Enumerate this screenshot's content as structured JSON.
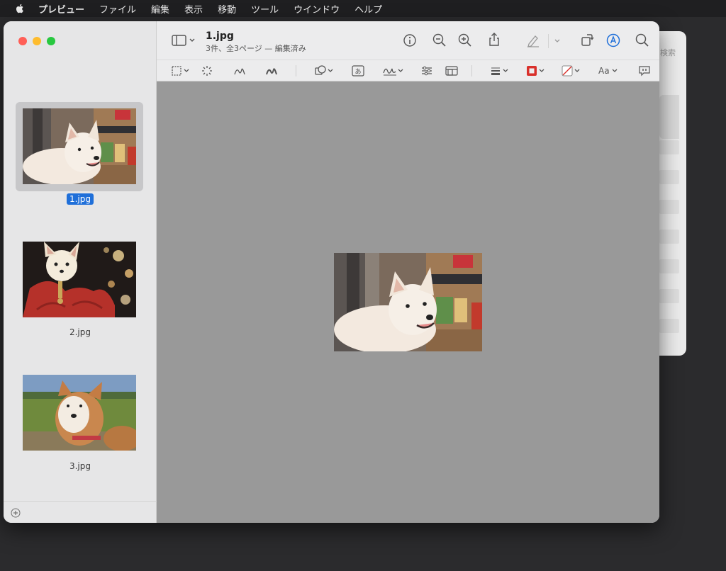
{
  "menubar": {
    "items": [
      "プレビュー",
      "ファイル",
      "編集",
      "表示",
      "移動",
      "ツール",
      "ウインドウ",
      "ヘルプ"
    ]
  },
  "background_window": {
    "search_label": "検索"
  },
  "window": {
    "title": "1.jpg",
    "subtitle": "3件、全3ページ — 編集済み"
  },
  "sidebar": {
    "items": [
      {
        "label": "1.jpg",
        "selected": true
      },
      {
        "label": "2.jpg",
        "selected": false
      },
      {
        "label": "3.jpg",
        "selected": false
      }
    ]
  },
  "toolbar": {
    "font_button_label": "Aa",
    "text_tool_glyph": "あ"
  },
  "colors": {
    "selection": "#1f6fd9",
    "canvas": "#999999",
    "border_color_swatch": "#d9302b"
  }
}
